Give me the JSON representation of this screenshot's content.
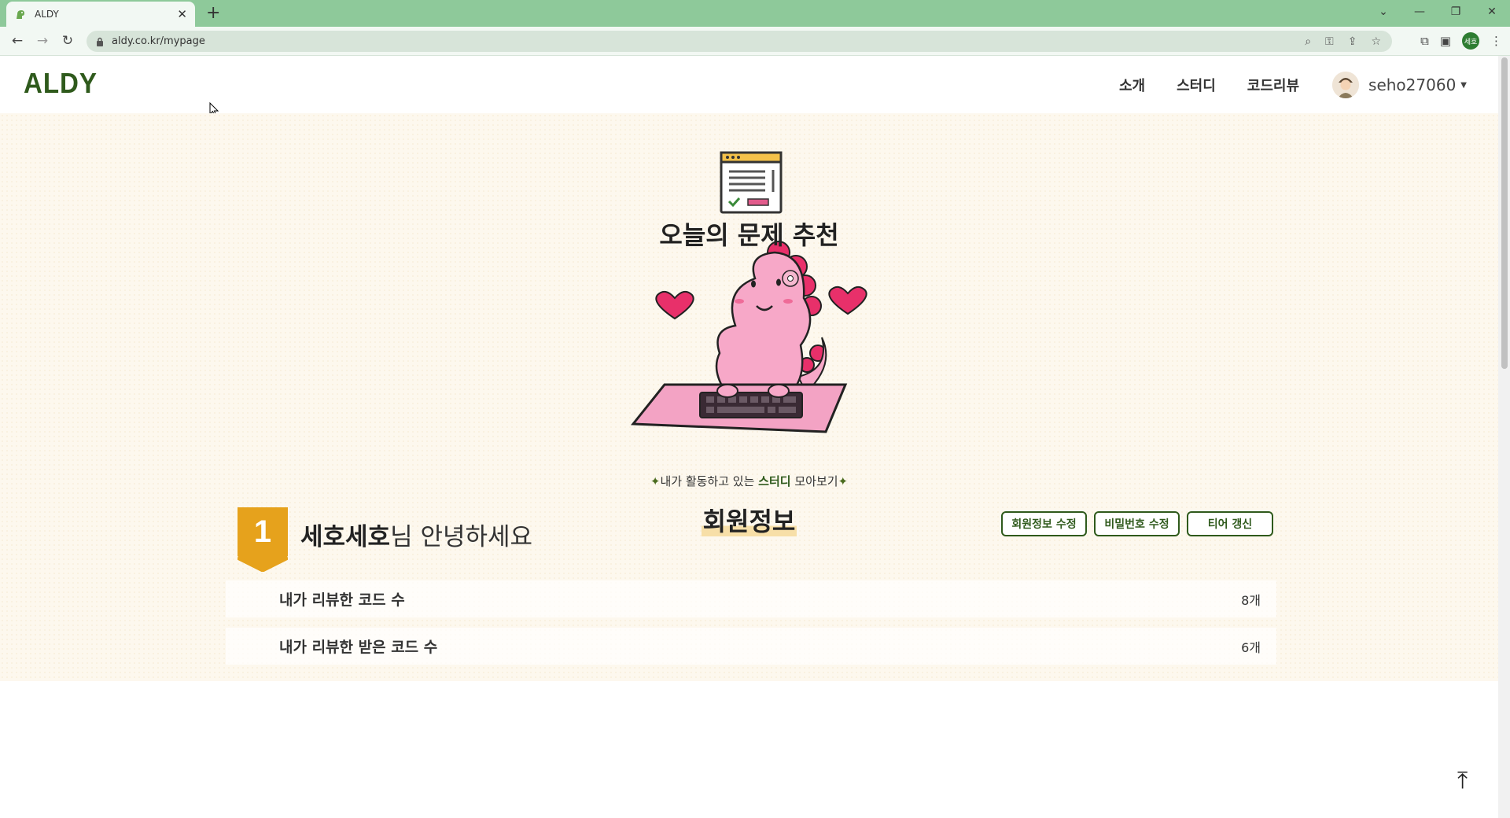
{
  "browser": {
    "tab_title": "ALDY",
    "url": "aldy.co.kr/mypage",
    "new_tab_label": "+",
    "profile_initials": "세호"
  },
  "site": {
    "logo": "ALDY",
    "nav": [
      "소개",
      "스터디",
      "코드리뷰"
    ],
    "username": "seho27060"
  },
  "hero": {
    "subtitle_prefix": "내가 활동하고 있는 ",
    "subtitle_highlight": "스터디",
    "subtitle_suffix": " 모아보기",
    "section_title": "회원정보",
    "tier": "1",
    "nickname": "세호세호",
    "greeting_suffix": "님 안녕하세요",
    "buttons": {
      "edit_info": "회원정보 수정",
      "edit_password": "비밀번호 수정",
      "refresh_tier": "티어 갱신"
    },
    "stats": [
      {
        "label": "내가 리뷰한 코드 수",
        "value": "8개"
      },
      {
        "label": "내가 리뷰한 받은 코드 수",
        "value": "6개"
      }
    ]
  },
  "recommend": {
    "title": "오늘의 문제 추천"
  },
  "colors": {
    "brand": "#2f5a1c",
    "tab_bar": "#8ec99a",
    "hero_bg": "#fdf8ee",
    "tier_gold": "#e6a21c"
  },
  "icons": [
    "lock-icon",
    "back-icon",
    "forward-icon",
    "reload-icon",
    "zoom-icon",
    "key-icon",
    "share-icon",
    "star-icon",
    "extension-icon",
    "sidepanel-icon",
    "menu-icon",
    "arrow-up-icon"
  ]
}
